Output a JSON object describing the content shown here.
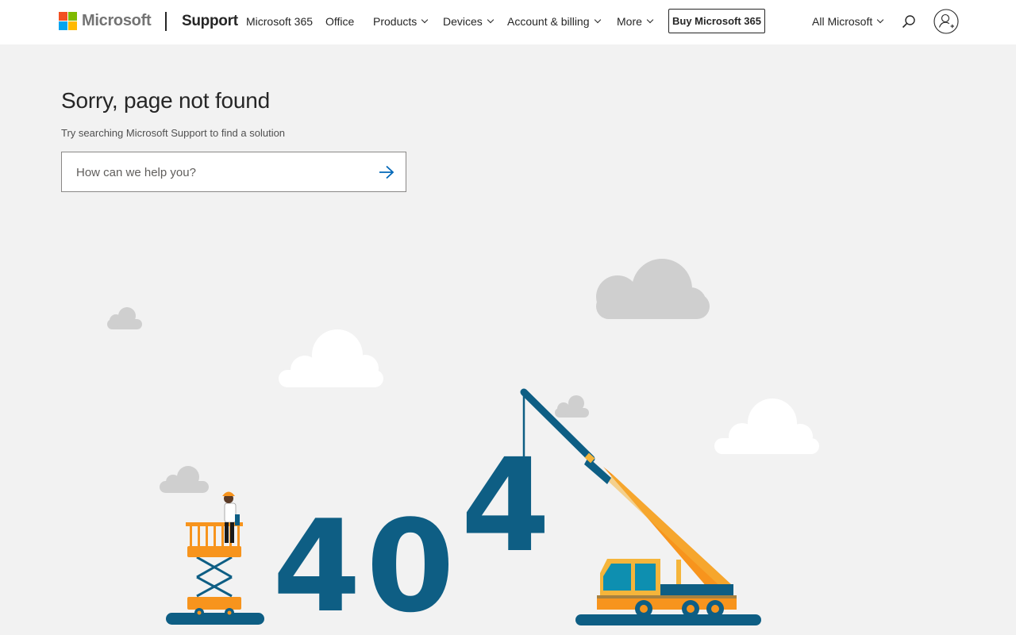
{
  "header": {
    "brand": "Microsoft",
    "section": "Support",
    "nav": [
      {
        "label": "Microsoft 365",
        "dropdown": false
      },
      {
        "label": "Office",
        "dropdown": false
      },
      {
        "label": "Products",
        "dropdown": true
      },
      {
        "label": "Devices",
        "dropdown": true
      },
      {
        "label": "Account & billing",
        "dropdown": true
      },
      {
        "label": "More",
        "dropdown": true
      }
    ],
    "cta": "Buy Microsoft 365",
    "all_microsoft": "All Microsoft",
    "icons": {
      "search": "search-icon",
      "account": "account-icon"
    }
  },
  "main": {
    "title": "Sorry, page not found",
    "subtitle": "Try searching Microsoft Support to find a solution",
    "search_placeholder": "How can we help you?",
    "search_value": ""
  },
  "illustration": {
    "digits": [
      "4",
      "0",
      "4"
    ]
  },
  "colors": {
    "logo_red": "#f25022",
    "logo_green": "#7fba00",
    "logo_blue": "#00a4ef",
    "logo_yellow": "#ffb900",
    "accent": "#0067b8",
    "digit": "#0e5e84",
    "machine": "#f7941d",
    "page_bg": "#f2f2f2"
  }
}
